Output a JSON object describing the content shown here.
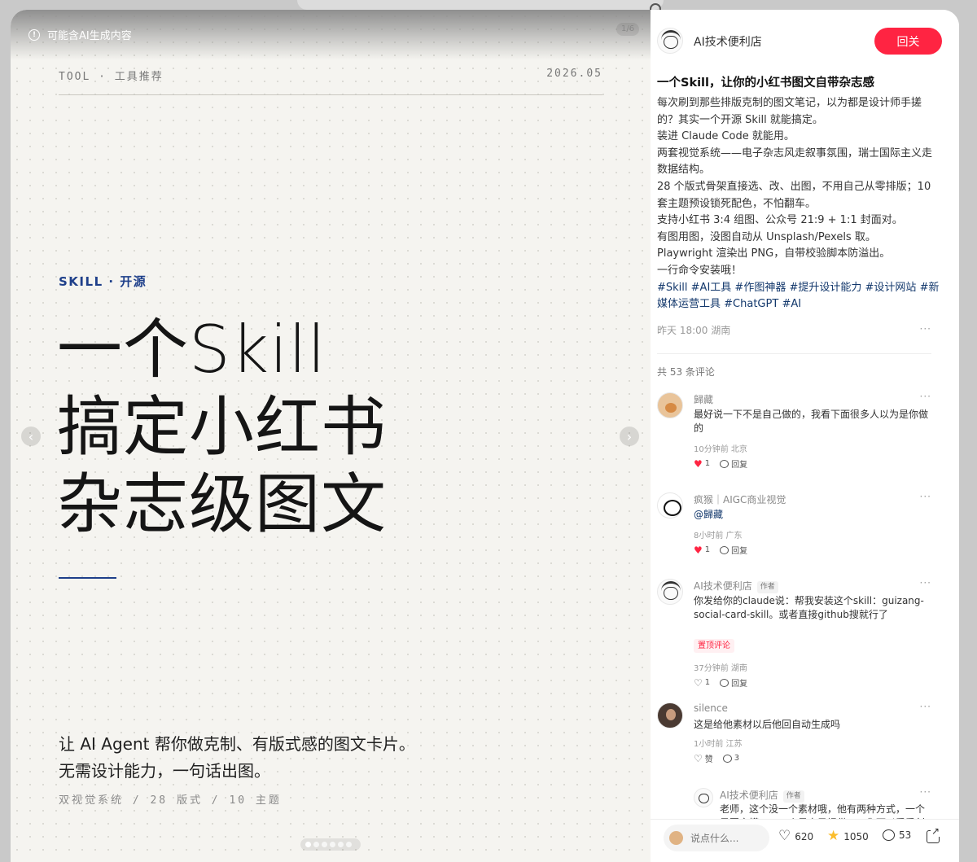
{
  "media": {
    "ai_notice": "可能含AI生成内容",
    "page_indicator": "1/6",
    "header_left": "TOOL · 工具推荐",
    "header_right": "2026.05",
    "kicker": "SKILL · 开源",
    "headline": [
      "一个Skill",
      "搞定小红书",
      "杂志级图文"
    ],
    "sub_lines": [
      "让 AI Agent 帮你做克制、有版式感的图文卡片。",
      "无需设计能力，一句话出图。"
    ],
    "meta_line": "双视觉系统  /  28 版式  /  10 主题",
    "prev_arrow": "‹",
    "next_arrow": "›"
  },
  "author": {
    "name": "AI技术便利店",
    "follow_label": "回关"
  },
  "post": {
    "title": "一个Skill，让你的小红书图文自带杂志感",
    "body": [
      "每次刷到那些排版克制的图文笔记，以为都是设计师手搓的？其实一个开源 Skill 就能搞定。",
      "装进 Claude Code 就能用。",
      "两套视觉系统——电子杂志风走叙事氛围，瑞士国际主义走数据结构。",
      "28 个版式骨架直接选、改、出图，不用自己从零排版；10 套主题预设锁死配色，不怕翻车。",
      "支持小红书 3:4 组图、公众号 21:9 + 1:1 封面对。",
      "有图用图，没图自动从 Unsplash/Pexels 取。",
      "Playwright 渲染出 PNG，自带校验脚本防溢出。",
      "一行命令安装哦！"
    ],
    "tags": [
      "#Skill",
      "#AI工具",
      "#作图神器",
      "#提升设计能力",
      "#设计网站",
      "#新媒体运营工具",
      "#ChatGPT",
      "#AI"
    ],
    "time_location": "昨天 18:00 湖南",
    "more": "···"
  },
  "comments": {
    "count_label": "共 53 条评论",
    "items": [
      {
        "name": "歸藏",
        "text": "最好说一下不是自己做的，我看下面很多人以为是你做的",
        "time": "10分钟前 北京",
        "likes": "1",
        "reply_label": "回复"
      },
      {
        "name": "疯猴｜AIGC商业视觉",
        "text": "@歸藏",
        "time": "8小时前 广东",
        "likes": "1",
        "reply_label": "回复"
      },
      {
        "name": "AI技术便利店",
        "author_tag": "作者",
        "text": "你发给你的claude说：帮我安装这个skill：guizang-social-card-skill。或者直接github搜就行了",
        "pin": "置顶评论",
        "time": "37分钟前 湖南",
        "likes": "1",
        "reply_label": "回复"
      },
      {
        "name": "silence",
        "text": "这是给他素材以后他回自动生成吗",
        "time": "1小时前 江苏",
        "likes": "赞",
        "replies": "3"
      }
    ],
    "reply": {
      "name": "AI技术便利店",
      "author_tag": "作者",
      "text": "老师，这个没一个素材哦，他有两种方式，一个是图文模……一个是自己提供……你可以看看创作者"
    }
  },
  "bottom_bar": {
    "input_placeholder": "说点什么...",
    "likes": "620",
    "stars": "1050",
    "comments": "53"
  },
  "colors": {
    "accent_red": "#ff2442",
    "brand_blue": "#1e3f8a",
    "tag_blue": "#13386c"
  }
}
